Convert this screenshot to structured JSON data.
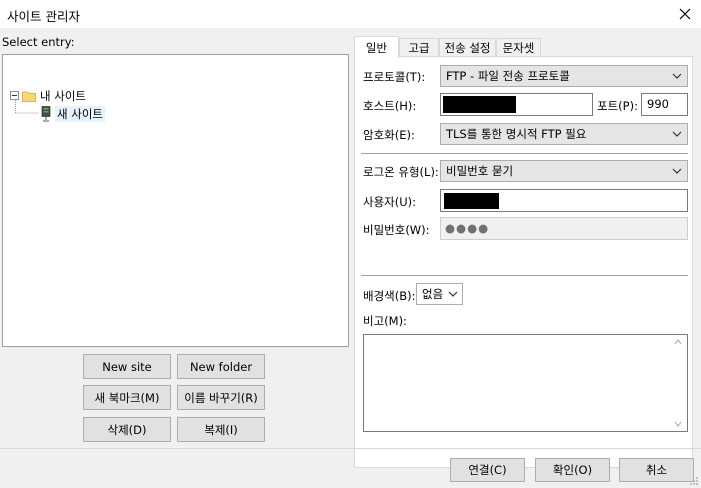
{
  "window": {
    "title": "사이트 관리자"
  },
  "left": {
    "select_label": "Select entry:",
    "tree": {
      "root": "내 사이트",
      "child": "새 사이트"
    },
    "buttons": {
      "new_site": "New site",
      "new_folder": "New folder",
      "new_bookmark": "새 북마크(M)",
      "rename": "이름 바꾸기(R)",
      "delete": "삭제(D)",
      "duplicate": "복제(I)"
    }
  },
  "tabs": [
    "일반",
    "고급",
    "전송 설정",
    "문자셋"
  ],
  "general": {
    "protocol_label": "프로토콜(T):",
    "protocol_value": "FTP - 파일 전송 프로토콜",
    "host_label": "호스트(H):",
    "port_label": "포트(P):",
    "port_value": "990",
    "encryption_label": "암호화(E):",
    "encryption_value": "TLS를 통한 명시적 FTP 필요",
    "logon_label": "로그온 유형(L):",
    "logon_value": "비밀번호 묻기",
    "user_label": "사용자(U):",
    "password_label": "비밀번호(W):",
    "password_mask": "●●●●",
    "bgcolor_label": "배경색(B):",
    "bgcolor_value": "없음",
    "comments_label": "비고(M):"
  },
  "footer": {
    "connect": "연결(C)",
    "ok": "확인(O)",
    "cancel": "취소"
  }
}
